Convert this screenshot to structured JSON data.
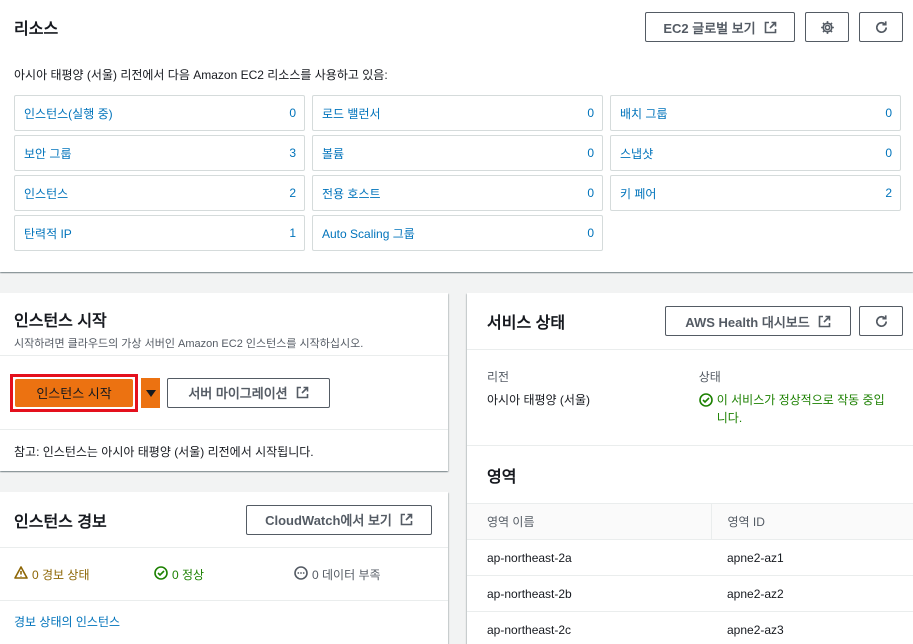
{
  "resources": {
    "title": "리소스",
    "global_view_button": "EC2 글로벌 보기",
    "intro": "아시아 태평양 (서울) 리전에서 다음 Amazon EC2 리소스를 사용하고 있음:",
    "items": [
      {
        "label": "인스턴스(실행 중)",
        "count": "0"
      },
      {
        "label": "로드 밸런서",
        "count": "0"
      },
      {
        "label": "배치 그룹",
        "count": "0"
      },
      {
        "label": "보안 그룹",
        "count": "3"
      },
      {
        "label": "볼륨",
        "count": "0"
      },
      {
        "label": "스냅샷",
        "count": "0"
      },
      {
        "label": "인스턴스",
        "count": "2"
      },
      {
        "label": "전용 호스트",
        "count": "0"
      },
      {
        "label": "키 페어",
        "count": "2"
      },
      {
        "label": "탄력적 IP",
        "count": "1"
      },
      {
        "label": "Auto Scaling 그룹",
        "count": "0"
      }
    ]
  },
  "launch": {
    "title": "인스턴스 시작",
    "subtitle": "시작하려면 클라우드의 가상 서버인 Amazon EC2 인스턴스를 시작하십시오.",
    "launch_button": "인스턴스 시작",
    "migrate_button": "서버 마이그레이션",
    "note": "참고: 인스턴스는 아시아 태평양 (서울) 리전에서 시작됩니다."
  },
  "alarms": {
    "title": "인스턴스 경보",
    "cloudwatch_button": "CloudWatch에서 보기",
    "alarm_state": "0 경보 상태",
    "ok_state": "0 정상",
    "insufficient": "0 데이터 부족",
    "link": "경보 상태의 인스턴스"
  },
  "health": {
    "title": "서비스 상태",
    "dashboard_button": "AWS Health 대시보드",
    "region_label": "리전",
    "region_value": "아시아 태평양 (서울)",
    "status_label": "상태",
    "status_value": "이 서비스가 정상적으로 작동 중입니다.",
    "zones_title": "영역",
    "col_name": "영역 이름",
    "col_id": "영역 ID",
    "zones": [
      {
        "name": "ap-northeast-2a",
        "id": "apne2-az1"
      },
      {
        "name": "ap-northeast-2b",
        "id": "apne2-az2"
      },
      {
        "name": "ap-northeast-2c",
        "id": "apne2-az3"
      }
    ]
  },
  "colors": {
    "accent": "#ec7211",
    "link": "#0073bb",
    "success": "#1d8102",
    "warning": "#8d6605",
    "highlight": "#e4101d"
  }
}
